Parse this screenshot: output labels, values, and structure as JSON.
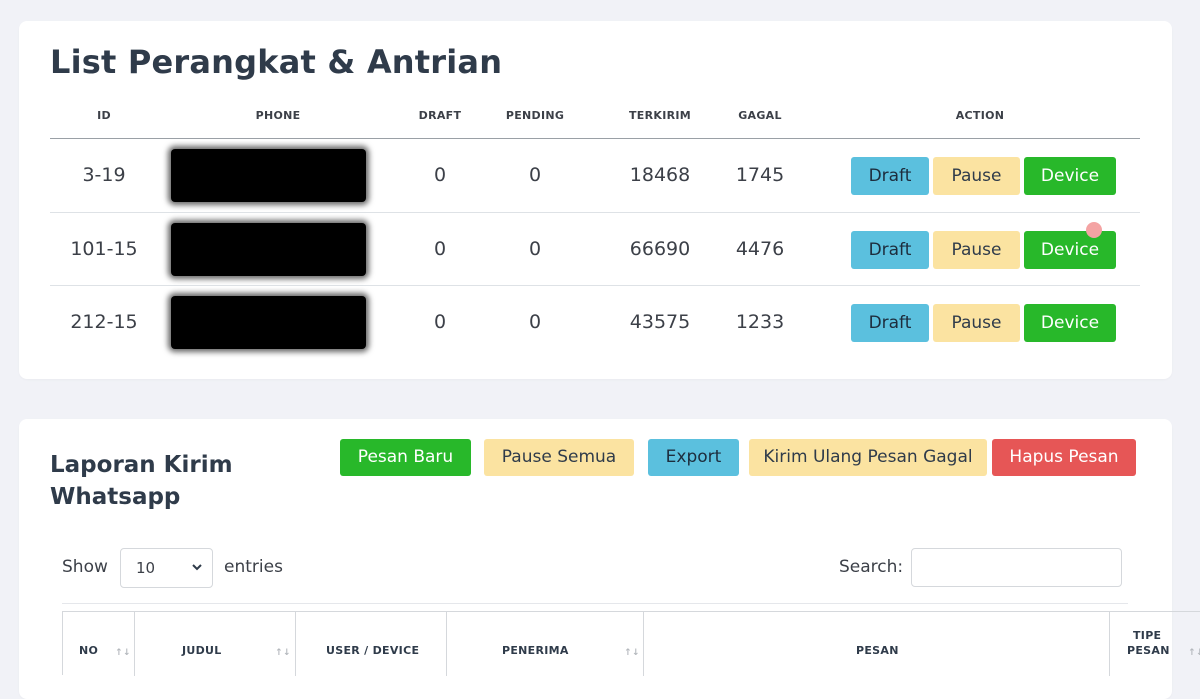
{
  "devices_card": {
    "title": "List Perangkat & Antrian",
    "columns": [
      "ID",
      "PHONE",
      "DRAFT",
      "PENDING",
      "TERKIRIM",
      "GAGAL",
      "ACTION"
    ],
    "rows": [
      {
        "id": "3-19",
        "draft": "0",
        "pending": "0",
        "terkirim": "18468",
        "gagal": "1745"
      },
      {
        "id": "101-15",
        "draft": "0",
        "pending": "0",
        "terkirim": "66690",
        "gagal": "4476"
      },
      {
        "id": "212-15",
        "draft": "0",
        "pending": "0",
        "terkirim": "43575",
        "gagal": "1233"
      }
    ],
    "actions": {
      "draft": "Draft",
      "pause": "Pause",
      "device": "Device"
    }
  },
  "report_card": {
    "title": "Laporan Kirim Whatsapp",
    "buttons": {
      "new": "Pesan Baru",
      "pause_all": "Pause Semua",
      "export": "Export",
      "resend_failed": "Kirim Ulang Pesan Gagal",
      "delete": "Hapus Pesan"
    },
    "show_label": "Show",
    "entries_select": "10",
    "entries_label": "entries",
    "search_label": "Search:",
    "search_value": "",
    "columns": {
      "no": "NO",
      "judul": "JUDUL",
      "user_device": "USER / DEVICE",
      "penerima": "PENERIMA",
      "pesan": "PESAN",
      "tipe_pesan_1": "TIPE",
      "tipe_pesan_2": "PESAN"
    }
  },
  "colors": {
    "info": "#5bc0de",
    "warning": "#fbe3a1",
    "success": "#28b82a",
    "danger": "#e65656"
  },
  "icons": {
    "select_chevron": "chevron-down-icon",
    "sort": "sort-icon"
  }
}
